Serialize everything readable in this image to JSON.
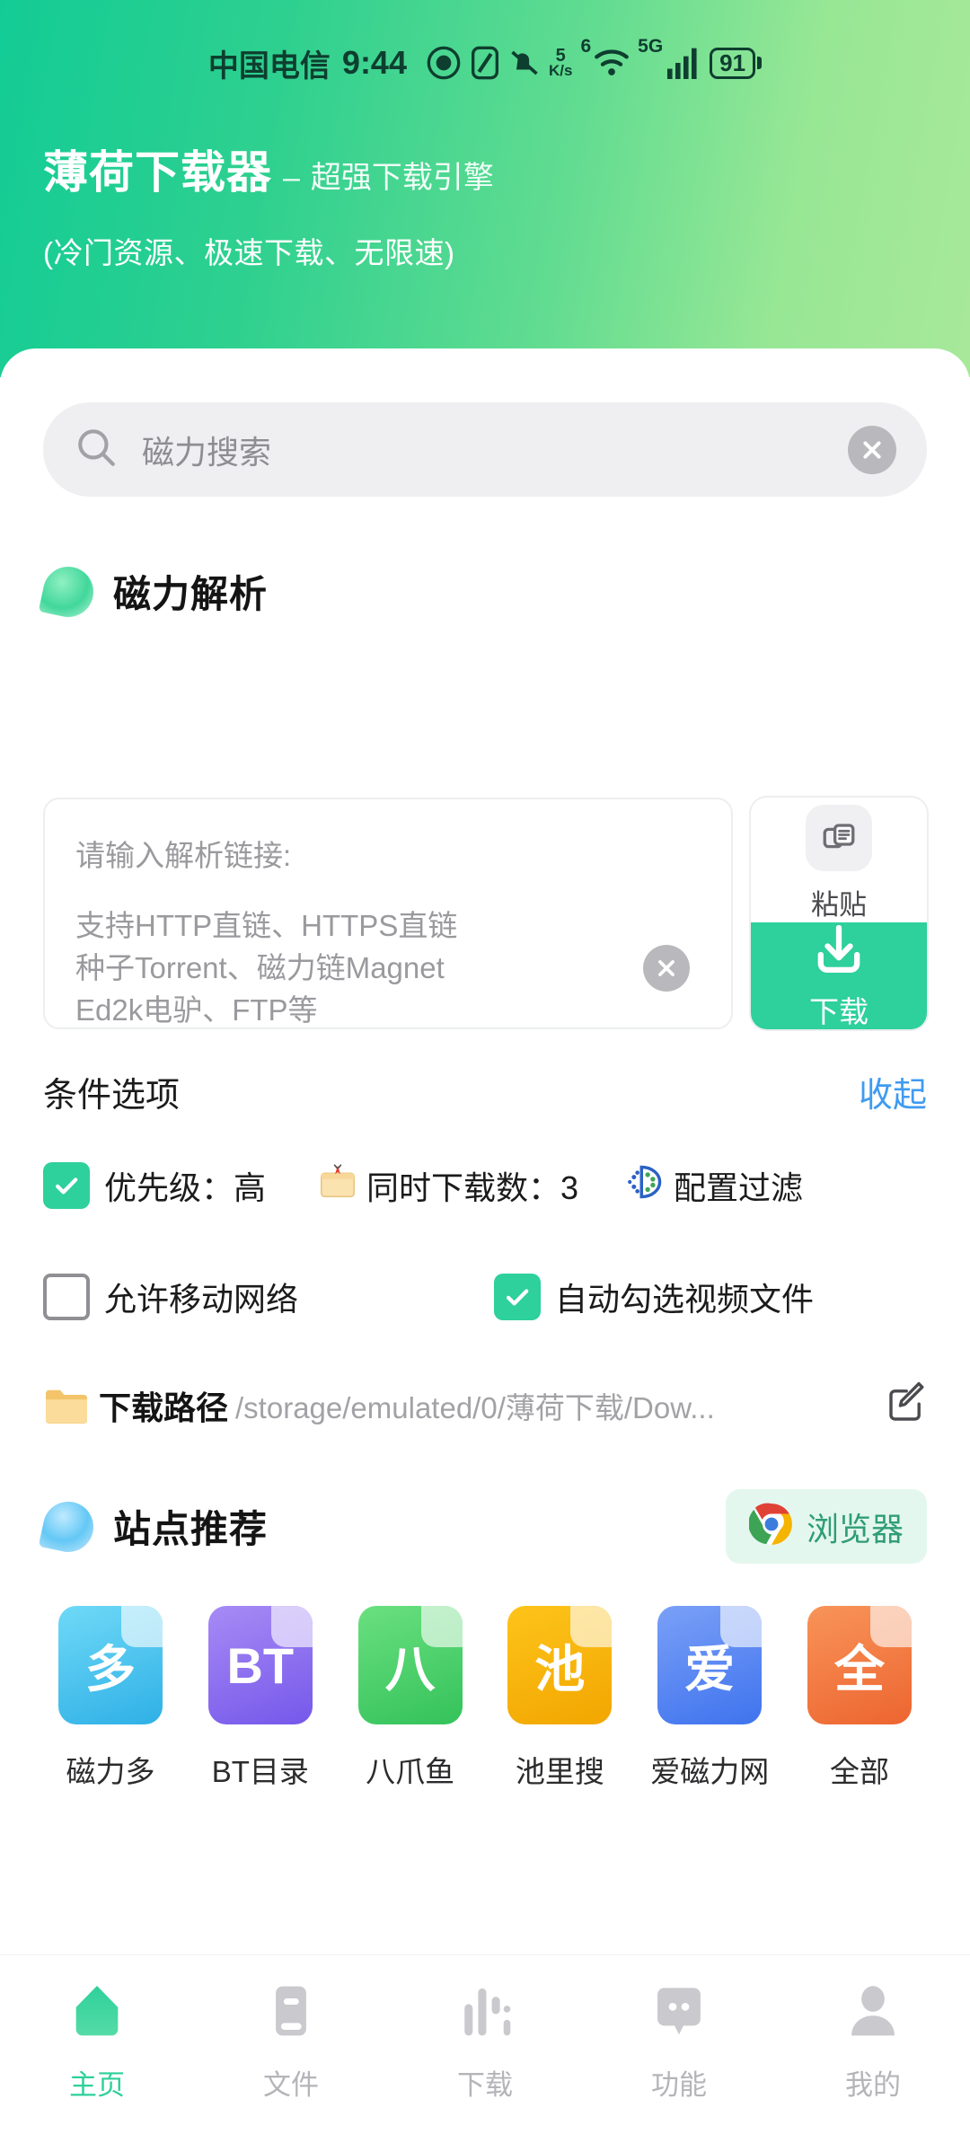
{
  "statusbar": {
    "carrier": "中国电信",
    "time": "9:44",
    "netspeed_value": "5",
    "netspeed_unit": "K/s",
    "wifi_badge": "6",
    "network_type": "5G",
    "battery": "91",
    "icons": [
      "eye-icon",
      "nfc-icon",
      "mute-bell-icon",
      "netspeed-icon",
      "wifi-icon",
      "signal-bars-icon",
      "battery-icon"
    ]
  },
  "header": {
    "title": "薄荷下载器",
    "dash": "–",
    "subtitle": "超强下载引擎",
    "tagline": "(冷门资源、极速下载、无限速)",
    "gradient_from": "#13cc95",
    "gradient_to": "#a8e89a"
  },
  "search": {
    "placeholder": "磁力搜索",
    "search_icon": "search-icon",
    "clear_icon": "clear-circle-icon"
  },
  "magnet_parse": {
    "section_title": "磁力解析",
    "section_icon": "green-leaf-icon",
    "input_label": "请输入解析链接:",
    "input_hint_line1": "支持HTTP直链、HTTPS直链",
    "input_hint_line2": "种子Torrent、磁力链Magnet",
    "input_hint_line3": "Ed2k电驴、FTP等",
    "clear_icon": "clear-circle-icon",
    "paste_label": "粘贴",
    "paste_icon": "copy-paste-icon",
    "download_label": "下载",
    "download_icon": "download-arrow-icon",
    "download_color": "#2ed09b"
  },
  "options": {
    "title": "条件选项",
    "collapse_label": "收起",
    "collapse_color": "#3f9bf0",
    "row1": [
      {
        "name": "priority",
        "icon": "checkbox-checked-icon",
        "checked": true,
        "label": "优先级：高"
      },
      {
        "name": "concurrent-downloads",
        "icon": "card-index-emoji",
        "emoji": "🗂",
        "label": "同时下载数：3"
      },
      {
        "name": "configure-filter",
        "icon": "filter-emoji",
        "emoji": "",
        "label": "配置过滤"
      }
    ],
    "row2": [
      {
        "name": "allow-mobile-network",
        "icon": "checkbox-unchecked-icon",
        "checked": false,
        "label": "允许移动网络"
      },
      {
        "name": "auto-select-video",
        "icon": "checkbox-checked-icon",
        "checked": true,
        "label": "自动勾选视频文件"
      }
    ],
    "path": {
      "icon": "folder-icon",
      "label": "下载路径",
      "value": "/storage/emulated/0/薄荷下载/Dow...",
      "edit_icon": "edit-pencil-icon"
    }
  },
  "sites": {
    "section_title": "站点推荐",
    "section_icon": "blue-drop-icon",
    "browser_label": "浏览器",
    "browser_icon": "chrome-icon",
    "items": [
      {
        "glyph": "多",
        "name": "磁力多",
        "color_from": "#5ed2f5",
        "color_to": "#2fb6e8"
      },
      {
        "glyph": "BT",
        "name": "BT目录",
        "color_from": "#9b7cf0",
        "color_to": "#7a58e8"
      },
      {
        "glyph": "八",
        "name": "八爪鱼",
        "color_from": "#5fd878",
        "color_to": "#37c75e"
      },
      {
        "glyph": "池",
        "name": "池里搜",
        "color_from": "#fdc00d",
        "color_to": "#f5aa00"
      },
      {
        "glyph": "爱",
        "name": "爱磁力网",
        "color_from": "#6b96f5",
        "color_to": "#4277ee"
      },
      {
        "glyph": "全",
        "name": "全部",
        "color_from": "#f5894f",
        "color_to": "#ef6a33"
      }
    ]
  },
  "bottomnav": {
    "active_color": "#2ed09b",
    "inactive_color": "#b4b4b9",
    "items": [
      {
        "label": "主页",
        "icon": "home-icon",
        "active": true
      },
      {
        "label": "文件",
        "icon": "file-icon",
        "active": false
      },
      {
        "label": "下载",
        "icon": "downloads-icon",
        "active": false
      },
      {
        "label": "功能",
        "icon": "features-icon",
        "active": false
      },
      {
        "label": "我的",
        "icon": "profile-icon",
        "active": false
      }
    ]
  }
}
